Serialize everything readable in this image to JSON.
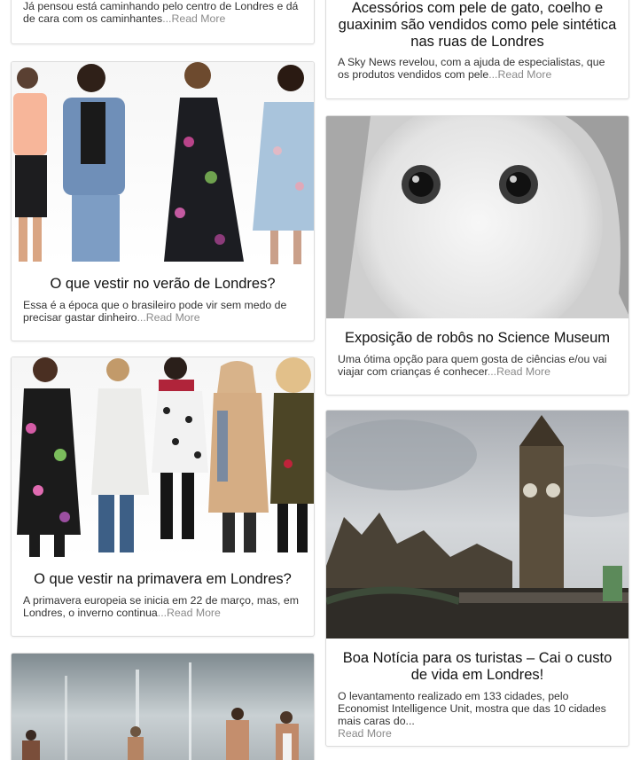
{
  "left": [
    {
      "title": "",
      "excerpt": "Já pensou está caminhando pelo centro de Londres e dá de cara com os caminhantes",
      "read_more": "...Read More"
    },
    {
      "title": "O que vestir no verão de Londres?",
      "excerpt": "Essa é a época que o brasileiro pode vir sem medo de precisar gastar dinheiro",
      "read_more": "...Read More"
    },
    {
      "title": "O que vestir na primavera em Londres?",
      "excerpt": "A primavera europeia se inicia em 22 de março, mas, em Londres, o inverno continua",
      "read_more": "...Read More"
    }
  ],
  "right": [
    {
      "title": "Acessórios com pele de gato, coelho e guaxinim são vendidos como pele sintética nas ruas de Londres",
      "excerpt": "A Sky News revelou, com a ajuda de especialistas, que os produtos vendidos com pele",
      "read_more": "...Read More"
    },
    {
      "title": "Exposição de robôs no Science Museum",
      "excerpt": "Uma ótima opção para quem gosta de ciências e/ou vai viajar com crianças é conhecer",
      "read_more": "...Read More"
    },
    {
      "title": "Boa Notícia para os turistas – Cai o custo de vida em Londres!",
      "excerpt": "O levantamento realizado em 133 cidades, pelo Economist Intelligence Unit, mostra que das 10 cidades mais caras do...",
      "read_more": "Read More"
    }
  ]
}
